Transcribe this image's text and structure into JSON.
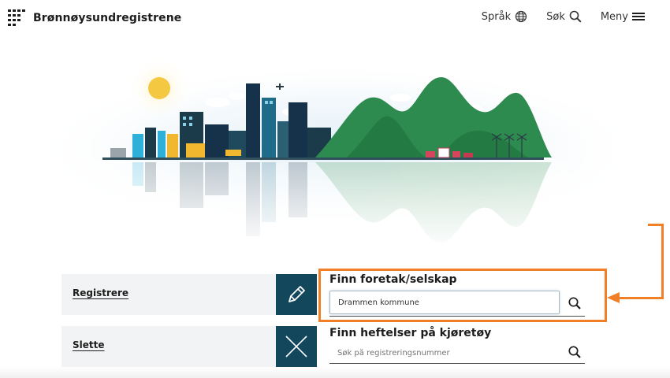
{
  "header": {
    "brand": "Brønnøysundregistrene",
    "nav": [
      {
        "label": "Språk",
        "icon": "globe-icon"
      },
      {
        "label": "Søk",
        "icon": "search-icon"
      },
      {
        "label": "Meny",
        "icon": "hamburger-menu-icon"
      }
    ]
  },
  "cards": [
    {
      "label": "Registrere",
      "icon": "pencil-icon"
    },
    {
      "label": "Slette",
      "icon": "x-close-icon"
    }
  ],
  "search_company": {
    "title": "Finn foretak/selskap",
    "value": "Drammen kommune"
  },
  "search_vehicle": {
    "title": "Finn heftelser på kjøretøy",
    "placeholder": "Søk på registreringsnummer"
  },
  "colors": {
    "card_icon_bg": "#13475c",
    "card_bg": "#f2f3f4",
    "annotation": "#f07f28",
    "hill_green": "#2e8b4f",
    "sun": "#f5c842"
  }
}
